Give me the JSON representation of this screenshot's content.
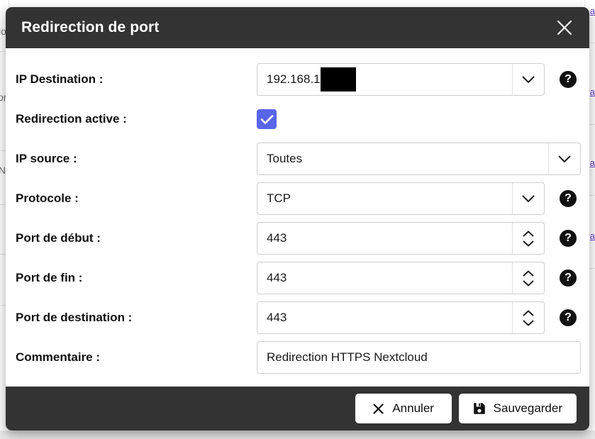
{
  "dialog": {
    "title": "Redirection de port",
    "close_icon": "close-icon",
    "help_icon_glyph": "?"
  },
  "background": {
    "fragments": [
      "lo",
      "or",
      "N"
    ],
    "links": [
      "a",
      "a",
      "a",
      "a"
    ]
  },
  "form": {
    "rows": [
      {
        "label": "IP Destination :",
        "type": "select",
        "value": "192.168.1",
        "redacted": true,
        "help": true
      },
      {
        "label": "Redirection active :",
        "type": "checkbox",
        "checked": true,
        "help": false
      },
      {
        "label": "IP source :",
        "type": "select",
        "value": "Toutes",
        "help": false
      },
      {
        "label": "Protocole :",
        "type": "select",
        "value": "TCP",
        "help": true
      },
      {
        "label": "Port de début :",
        "type": "number",
        "value": "443",
        "help": true
      },
      {
        "label": "Port de fin :",
        "type": "number",
        "value": "443",
        "help": true
      },
      {
        "label": "Port de destination :",
        "type": "number",
        "value": "443",
        "help": true
      },
      {
        "label": "Commentaire :",
        "type": "text",
        "value": "Redirection HTTPS Nextcloud",
        "help": false
      }
    ]
  },
  "footer": {
    "cancel_label": "Annuler",
    "save_label": "Sauvegarder"
  },
  "colors": {
    "header_bg": "#333333",
    "footer_bg": "#333333",
    "checkbox_accent": "#5865e8",
    "help_icon_bg": "#111111",
    "link": "#6b3fd4"
  }
}
